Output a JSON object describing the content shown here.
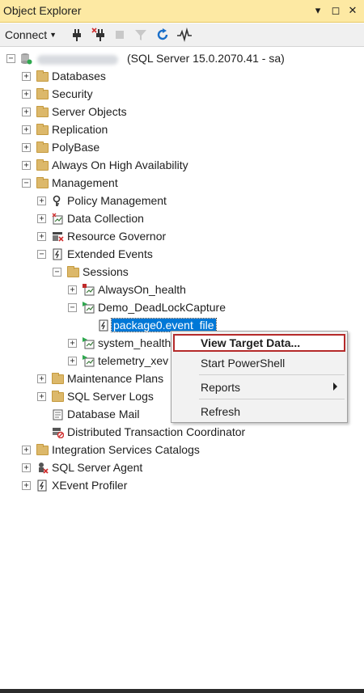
{
  "window": {
    "title": "Object Explorer",
    "pin_glyph": "▾",
    "maximize_glyph": "◻",
    "close_glyph": "✕"
  },
  "toolbar": {
    "connect_label": "Connect",
    "icons": [
      "connect-plug-icon",
      "disconnect-plug-icon",
      "stop-icon",
      "filter-icon",
      "refresh-icon",
      "activity-monitor-icon"
    ]
  },
  "tree": {
    "server": {
      "name_suffix": "(SQL Server 15.0.2070.41 - sa)"
    },
    "top_nodes": {
      "databases": "Databases",
      "security": "Security",
      "server_objects": "Server Objects",
      "replication": "Replication",
      "polybase": "PolyBase",
      "always_on": "Always On High Availability",
      "management": "Management",
      "integration_services": "Integration Services Catalogs",
      "sql_agent": "SQL Server Agent",
      "xevent_profiler": "XEvent Profiler"
    },
    "management": {
      "policy": "Policy Management",
      "data_collection": "Data Collection",
      "resource_governor": "Resource Governor",
      "extended_events": "Extended Events",
      "maintenance_plans": "Maintenance Plans",
      "sql_logs": "SQL Server Logs",
      "database_mail": "Database Mail",
      "dtc": "Distributed Transaction Coordinator"
    },
    "sessions": {
      "label": "Sessions",
      "alwayson": "AlwaysOn_health",
      "demo": "Demo_DeadLockCapture",
      "target": "package0.event_file",
      "system_health": "system_health",
      "telemetry": "telemetry_xev"
    },
    "expander_plus": "+",
    "expander_minus": "−"
  },
  "context_menu": {
    "view_target_data": "View Target Data...",
    "start_powershell": "Start PowerShell",
    "reports": "Reports",
    "refresh": "Refresh"
  },
  "colors": {
    "title_bar": "#fde9a3",
    "selection": "#0078d7",
    "highlight_border": "#b52a2a",
    "folder": "#dcb86a"
  }
}
